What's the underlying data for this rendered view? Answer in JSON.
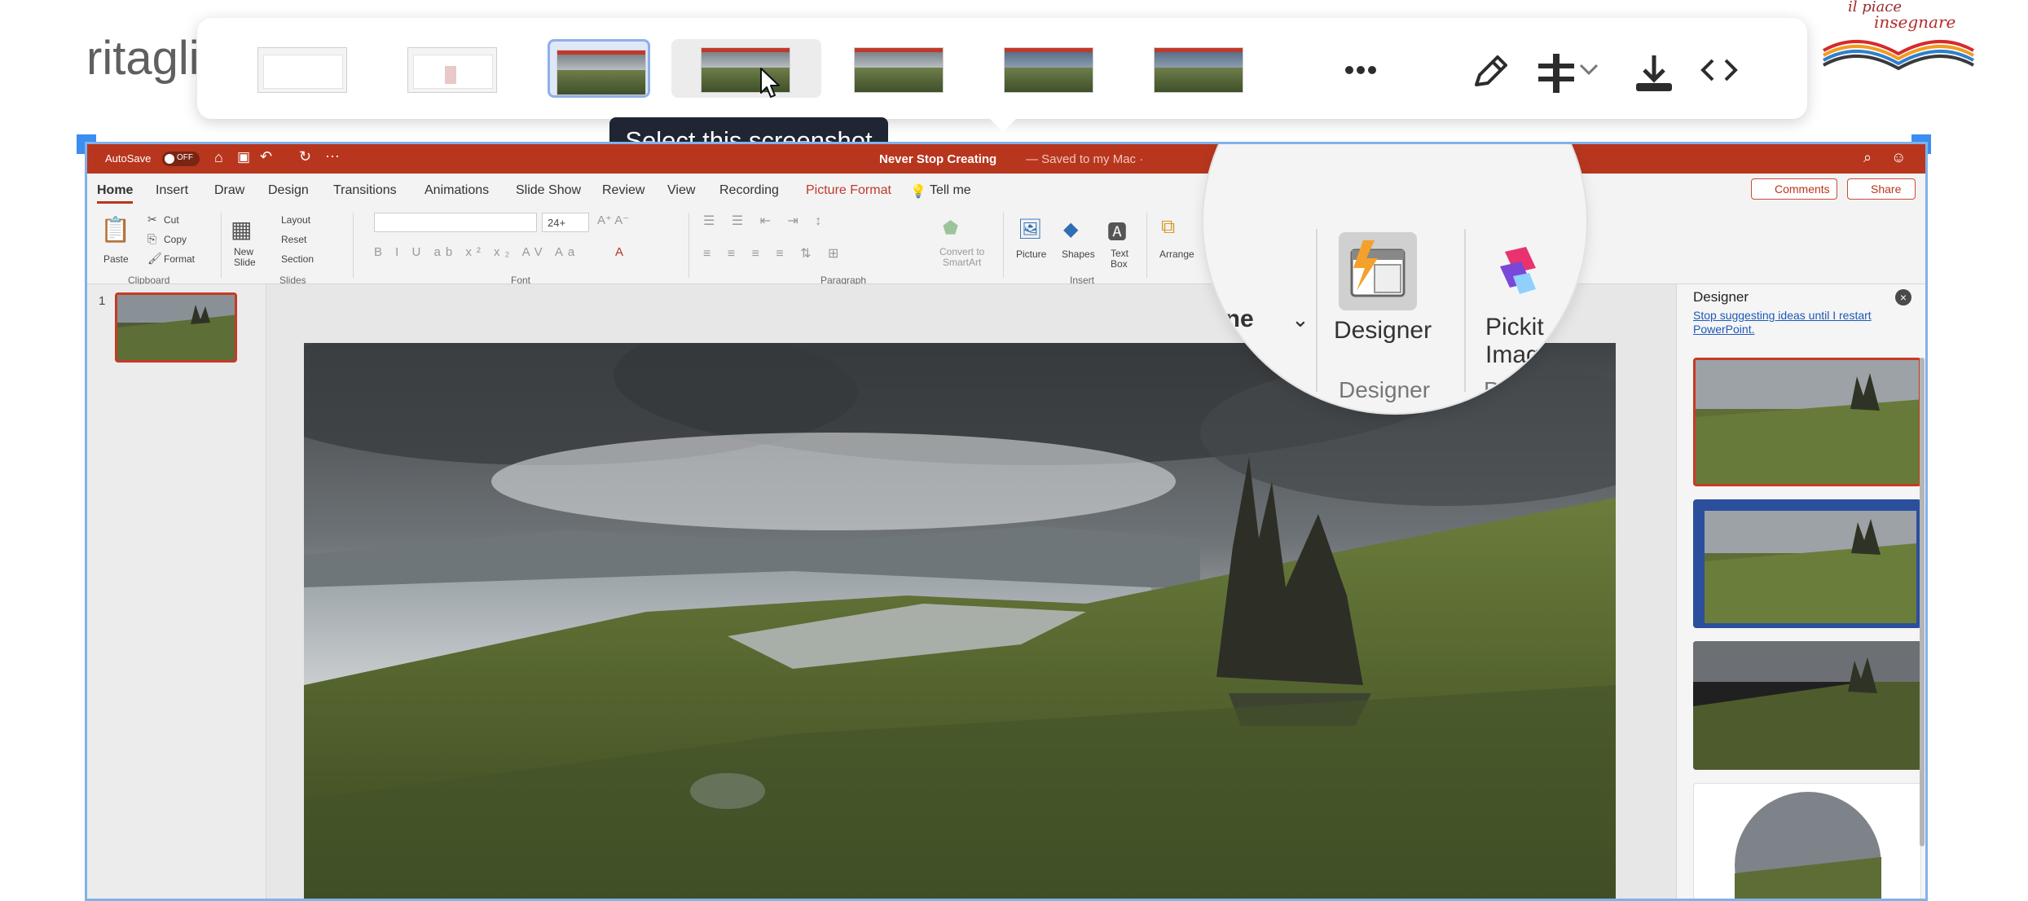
{
  "page": {
    "background_word": "ritagli",
    "logo_text_top": "il piace",
    "logo_text_bottom": "insegnare"
  },
  "picker": {
    "thumbnails": [
      {
        "label": "",
        "kind": "blank"
      },
      {
        "label": "",
        "kind": "blank-red"
      },
      {
        "label": "",
        "kind": "landscape",
        "state": "selected"
      },
      {
        "label": "",
        "kind": "landscape",
        "state": "hover"
      },
      {
        "label": "",
        "kind": "landscape-red"
      },
      {
        "label": "",
        "kind": "landscape-blue"
      },
      {
        "label": "",
        "kind": "landscape-blue"
      }
    ],
    "tooltip": "Select this screenshot",
    "icons": [
      "more-icon",
      "pencil-icon",
      "crop-icon",
      "chevron-down-icon",
      "download-icon",
      "code-icon"
    ]
  },
  "ppt": {
    "titlebar": {
      "autosave": "AutoSave",
      "autosave_state": "OFF",
      "doc_title": "Never Stop Creating",
      "saved_state": "— Saved to my Mac ·"
    },
    "tabs": [
      "Home",
      "Insert",
      "Draw",
      "Design",
      "Transitions",
      "Animations",
      "Slide Show",
      "Review",
      "View",
      "Recording",
      "Picture Format"
    ],
    "tell_me": "Tell me",
    "comments": "Comments",
    "share": "Share",
    "ribbon": {
      "paste": "Paste",
      "cut": "Cut",
      "copy": "Copy",
      "format": "Format",
      "clipboard": "Clipboard",
      "new_slide": "New\nSlide",
      "layout": "Layout",
      "reset": "Reset",
      "section": "Section",
      "slides": "Slides",
      "font_size": "24+",
      "font": "Font",
      "paragraph": "Paragraph",
      "convert": "Convert to\nSmartArt",
      "picture": "Picture",
      "shapes": "Shapes",
      "text_box": "Text\nBox",
      "insert": "Insert",
      "arrange": "Arrange"
    },
    "slide_number": "1",
    "designer": {
      "title": "Designer",
      "link": "Stop suggesting ideas until I restart PowerPoint."
    },
    "magnifier": {
      "outline": "tline",
      "designer_btn": "Designer",
      "designer_group": "Designer",
      "pickit_btn": "Pickit\nImages",
      "pickit_group": "Pick"
    }
  },
  "colors": {
    "ppt_accent": "#b8361e",
    "selection_blue": "#3b8df0",
    "tooltip_bg": "#1f2533"
  }
}
